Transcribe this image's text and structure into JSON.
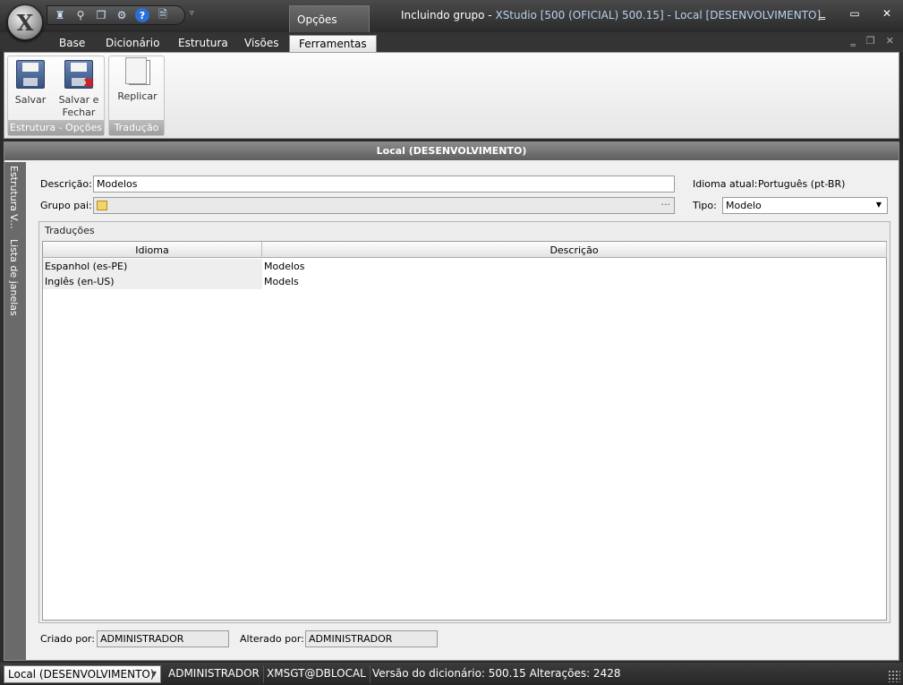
{
  "titlebar": {
    "app_logo": "X",
    "context_tab": "Opções",
    "title_prefix": "Incluindo grupo - ",
    "title_accent": "XStudio [500 (OFICIAL) 500.15] - Local [DESENVOLVIMENTO]",
    "qat_icons": [
      "user-settings-icon",
      "search-icon",
      "copy-icon",
      "gear-icon",
      "help-icon",
      "document-info-icon"
    ],
    "qat_customize": "▿",
    "minimize": "‗",
    "maximize": "▭",
    "close": "✕"
  },
  "ribbon": {
    "tabs": [
      "Base",
      "Dicionário",
      "Estrutura",
      "Visões",
      "Ferramentas"
    ],
    "active_tab": "Ferramentas",
    "mdi": {
      "minimize": "‗",
      "restore": "❐",
      "close": "✕"
    },
    "groups": [
      {
        "caption": "Estrutura - Opções",
        "buttons": [
          {
            "label": "Salvar",
            "icon": "save-icon"
          },
          {
            "label1": "Salvar e",
            "label2": "Fechar",
            "icon": "save-close-icon"
          }
        ]
      },
      {
        "caption": "Tradução",
        "buttons": [
          {
            "label": "Replicar",
            "icon": "replicate-icon"
          }
        ]
      }
    ]
  },
  "document": {
    "header": "Local (DESENVOLVIMENTO)",
    "side_tabs": [
      "Estrutura",
      "V...",
      "Lista de janelas"
    ],
    "form": {
      "descricao_label": "Descrição:",
      "descricao_value": "Modelos",
      "grupo_pai_label": "Grupo pai:",
      "grupo_pai_button": "···",
      "idioma_label": "Idioma atual:",
      "idioma_value": "Português (pt-BR)",
      "tipo_label": "Tipo:",
      "tipo_value": "Modelo"
    },
    "translations": {
      "title": "Traduções",
      "columns": [
        "Idioma",
        "Descrição"
      ],
      "rows": [
        [
          "Espanhol (es-PE)",
          "Modelos"
        ],
        [
          "Inglês (en-US)",
          "Models"
        ]
      ]
    },
    "footer": {
      "criado_label": "Criado por:",
      "criado_value": "ADMINISTRADOR",
      "alterado_label": "Alterado por:",
      "alterado_value": "ADMINISTRADOR"
    }
  },
  "statusbar": {
    "environment": "Local (DESENVOLVIMENTO)",
    "user": "ADMINISTRADOR",
    "connection": "XMSGT@DBLOCAL",
    "version": "Versão do dicionário: 500.15 Alterações: 2428"
  }
}
